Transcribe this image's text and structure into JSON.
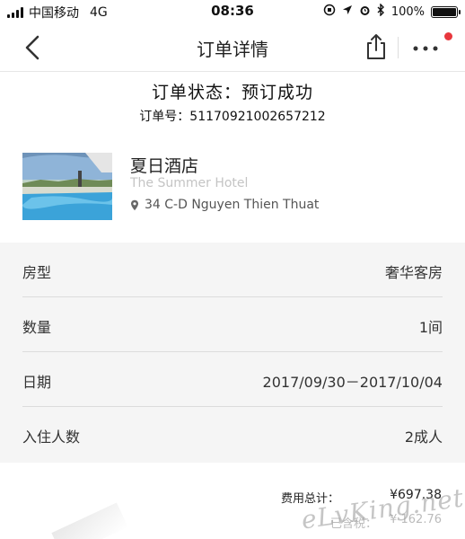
{
  "status_bar": {
    "carrier": "中国移动",
    "network": "4G",
    "time": "08:36",
    "battery": "100%"
  },
  "nav": {
    "title": "订单详情"
  },
  "order": {
    "status_text": "订单状态：预订成功",
    "number_label": "订单号：",
    "number": "51170921002657212"
  },
  "hotel": {
    "name": "夏日酒店",
    "name_en": "The Summer Hotel",
    "address": "34 C-D Nguyen Thien Thuat"
  },
  "details": [
    {
      "label": "房型",
      "value": "奢华客房"
    },
    {
      "label": "数量",
      "value": "1间"
    },
    {
      "label": "日期",
      "value": "2017/09/30－2017/10/04"
    },
    {
      "label": "入住人数",
      "value": "2成人"
    }
  ],
  "fees": {
    "total_label": "费用总计：",
    "total_value": "¥697.38",
    "tax_label": "已含税：",
    "tax_value": "¥ 162.76"
  },
  "watermark": "eLvKing.net",
  "colors": {
    "notification_dot": "#e8373d",
    "details_background": "#f5f5f5"
  },
  "icons": [
    "back-chevron-icon",
    "share-icon",
    "more-dots-icon",
    "location-pin-icon"
  ]
}
